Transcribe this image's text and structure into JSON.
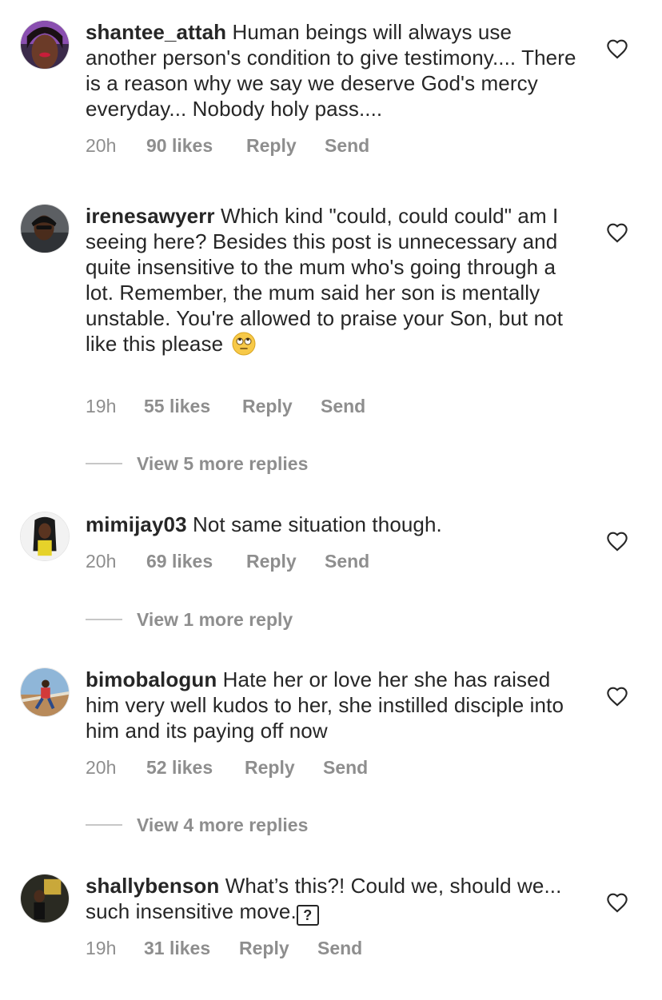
{
  "comments": [
    {
      "username": "shantee_attah",
      "text": "Human beings will always use another person's condition to give testimony.... There is a reason why we say we deserve God's mercy everyday... Nobody holy pass....",
      "time": "20h",
      "likes": "90 likes",
      "reply": "Reply",
      "send": "Send"
    },
    {
      "username": "irenesawyerr",
      "text": "Which kind \"could, could could\" am I seeing here? Besides this post is unnecessary and quite insensitive to the mum who's going through a lot. Remember, the mum said her son is mentally unstable. You're allowed to praise your Son, but not like this please",
      "emoji": "face-with-rolling-eyes",
      "time": "19h",
      "likes": "55 likes",
      "reply": "Reply",
      "send": "Send",
      "view_replies": "View 5 more replies"
    },
    {
      "username": "mimijay03",
      "text": "Not same situation though.",
      "time": "20h",
      "likes": "69 likes",
      "reply": "Reply",
      "send": "Send",
      "view_replies": "View 1 more reply"
    },
    {
      "username": "bimobalogun",
      "text": "Hate her or love her she has raised him very well kudos to her, she instilled disciple into him and its paying off now",
      "time": "20h",
      "likes": "52 likes",
      "reply": "Reply",
      "send": "Send",
      "view_replies": "View 4 more replies"
    },
    {
      "username": "shallybenson",
      "text": "What’s this?! Could we, should we... such insensitive move.",
      "unknown_glyph": "?",
      "time": "19h",
      "likes": "31 likes",
      "reply": "Reply",
      "send": "Send"
    }
  ],
  "colors": {
    "text": "#262626",
    "secondary": "#8e8e8e",
    "divider": "#c7c7c7"
  }
}
